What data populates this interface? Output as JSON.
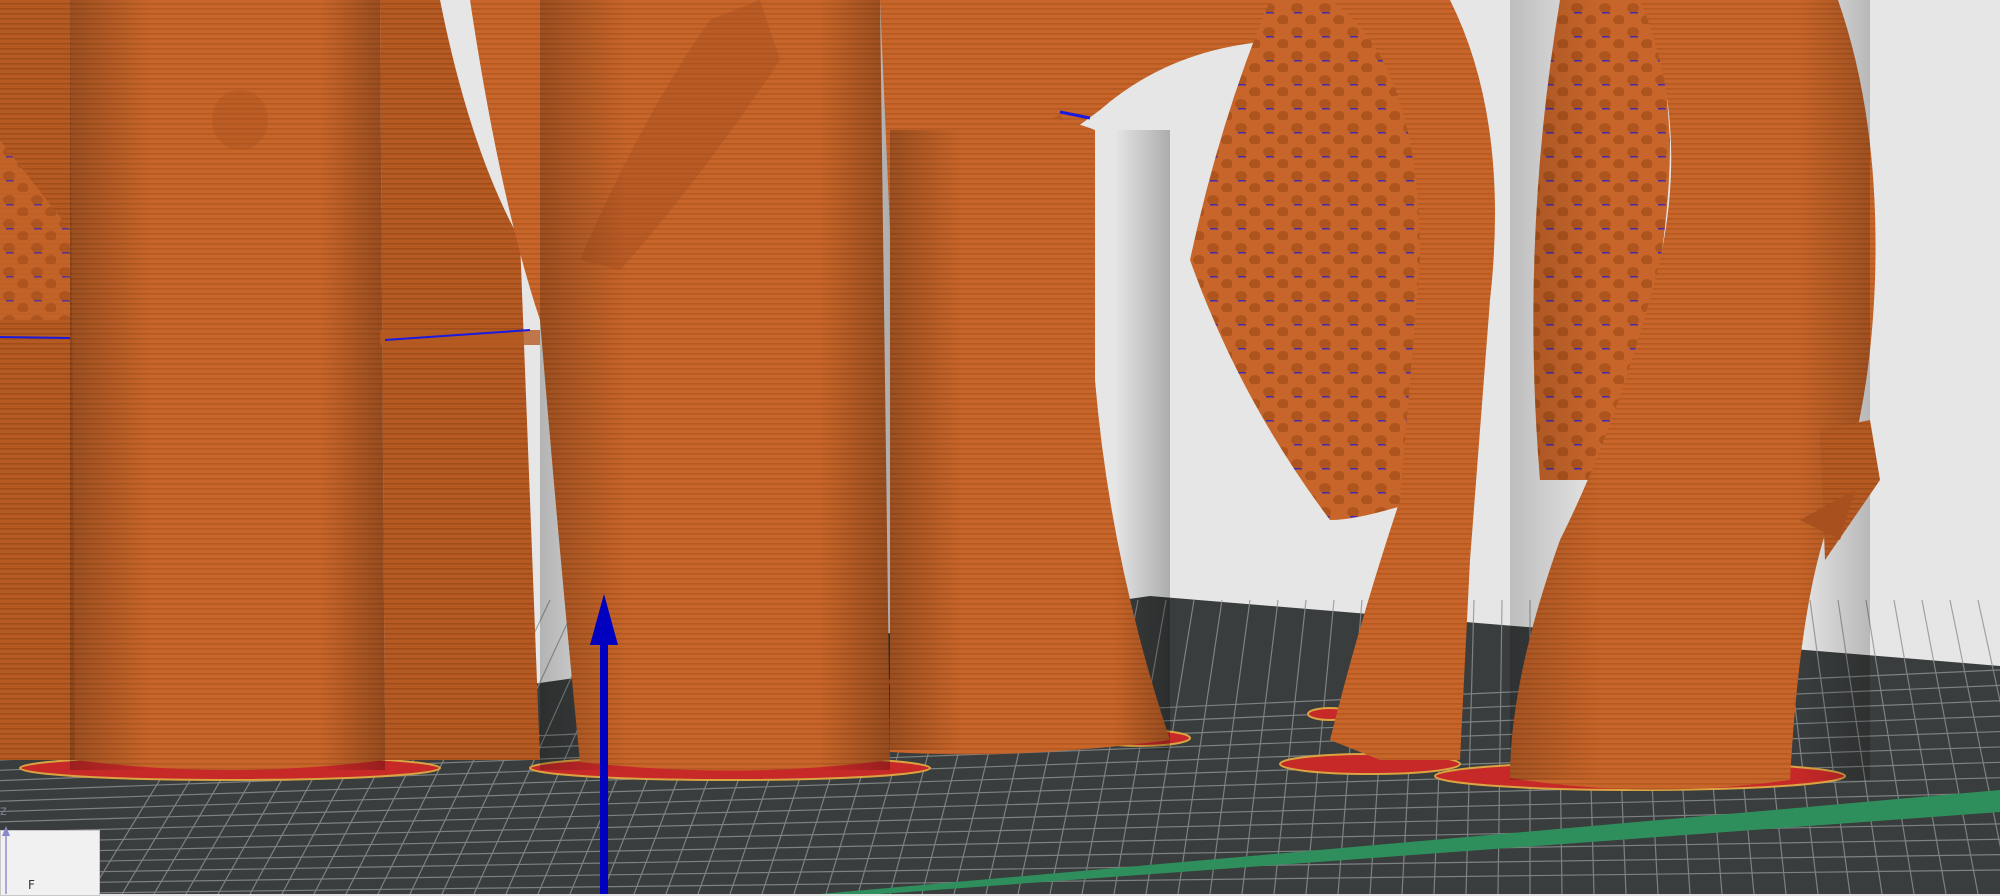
{
  "viewport": {
    "colors": {
      "background": "#e6e6e6",
      "bed": "#3a3d3d",
      "bed_grid": "#8e9292",
      "bed_edge_stripe": "#2f8f5c",
      "model": "#c7652a",
      "model_shadow": "#a8501e",
      "model_highlight": "#d9793b",
      "layer_line": "#9c4a16",
      "brim": "#c72828",
      "axis_z": "#0000c0",
      "overhang_marks": "#1a1ae0"
    }
  },
  "axis_widget": {
    "z_label": "z",
    "face_label": "F"
  }
}
